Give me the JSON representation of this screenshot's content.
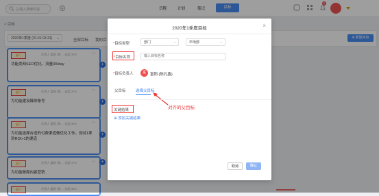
{
  "topbar": {
    "search_placeholder": "Q 输入搜索内容",
    "nav": [
      "日程",
      "计划",
      "笔记"
    ],
    "nav_active": "目标",
    "notification_count": "9"
  },
  "breadcrumb": "< 目标",
  "filter": {
    "quarter": "2020年1季度 (01.01-03.31)",
    "tabs": [
      "全部目标",
      "我的目"
    ],
    "new_goal": "⊕ 新建目标"
  },
  "cards": [
    {
      "tag": "部门",
      "meta": "负责人:富阳 (陈…  进度:35%",
      "title": "功能类网SEO优化，流量30/day"
    },
    {
      "tag": "部门",
      "meta": "负责人:富阳 (陈…  进度:37%",
      "title": "为功能建设媒体账号"
    },
    {
      "tag": "部门",
      "meta": "负责人:富阳 (陈…  进度:35%",
      "title": "为功能选择合适的付费渠道做优化工作，测试1拿到ROI>1的渠道"
    },
    {
      "tag": "部门",
      "meta": "负责人:富阳 (陈…  进度:47%",
      "title": "为功能做周内容营销"
    },
    {
      "tag": "部门",
      "meta": "负责人:富阳 (陈…  进度:38%",
      "title": ""
    }
  ],
  "modal": {
    "title": "2020年1季度目标",
    "goal_type_label": "目标类型",
    "goal_type_value": "部门",
    "dept_value": "市场部",
    "goal_name_label": "目标名称",
    "goal_name_placeholder": "输入目标名称",
    "owner_label": "目标负责人",
    "owner_avatar": "富",
    "owner_name": "富阳 (陈孔鑫)",
    "parent_label": "父目标",
    "parent_link": "选择父目标",
    "annotation": "对齐的父目标",
    "key_results_label": "关键结果",
    "add_key_result": "⊕ 添加关键结果",
    "cancel": "取消",
    "confirm": "确认"
  },
  "colors": {
    "accent": "#4a8ef4",
    "red": "#e33333",
    "link": "#3a7ef0"
  }
}
